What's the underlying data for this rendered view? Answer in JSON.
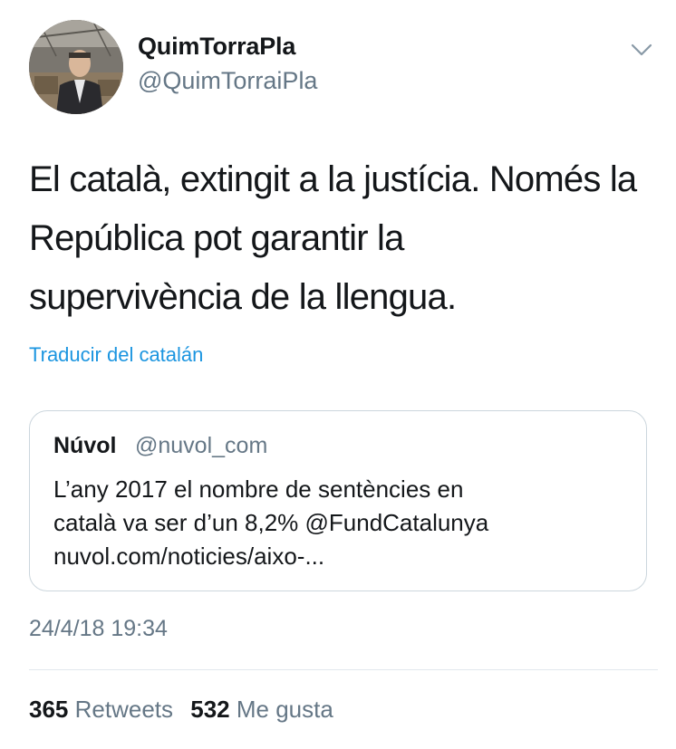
{
  "author": {
    "display_name": "QuimTorraPla",
    "handle": "@QuimTorraiPla"
  },
  "tweet": {
    "text": "El català, extingit a la justícia. Només la\nRepública pot garantir la\nsupervivència de la llengua.",
    "translate_label": "Traducir del catalán",
    "timestamp": "24/4/18 19:34"
  },
  "quoted": {
    "name": "Núvol",
    "handle": "@nuvol_com",
    "text": "L’any 2017 el nombre de sentències en\ncatalà va ser d’un 8,2%  @FundCatalunya\nnuvol.com/noticies/aixo-..."
  },
  "stats": {
    "retweets_count": "365",
    "retweets_label": "Retweets",
    "likes_count": "532",
    "likes_label": "Me gusta"
  },
  "icons": {
    "menu": "chevron-down-icon"
  },
  "colors": {
    "link": "#1b95e0",
    "secondary_text": "#657786",
    "primary_text": "#14171a",
    "border": "#ccd6dd"
  }
}
